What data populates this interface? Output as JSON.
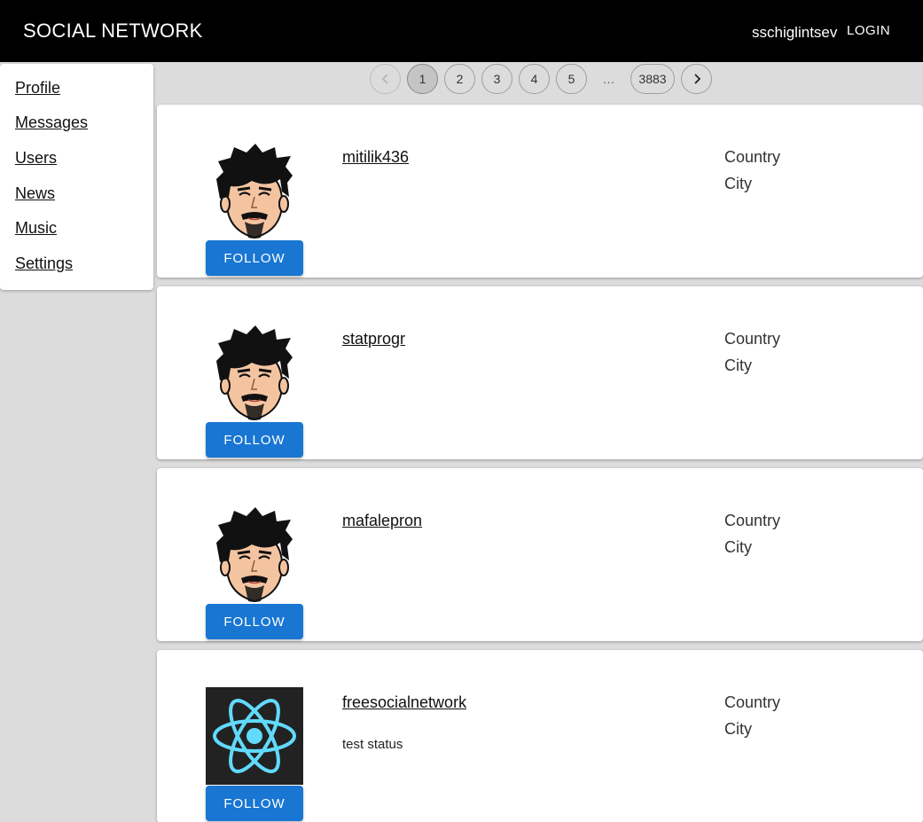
{
  "header": {
    "title": "SOCIAL NETWORK",
    "username": "sschiglintsev",
    "login_label": "LOGIN",
    "background": "#000000"
  },
  "sidebar": {
    "items": [
      {
        "label": "Profile"
      },
      {
        "label": "Messages"
      },
      {
        "label": "Users"
      },
      {
        "label": "News"
      },
      {
        "label": "Music"
      },
      {
        "label": "Settings"
      }
    ]
  },
  "pagination": {
    "prev_icon": "chevron-left-icon",
    "next_icon": "chevron-right-icon",
    "pages": [
      "1",
      "2",
      "3",
      "4",
      "5"
    ],
    "selected": "1",
    "ellipsis": "…",
    "last_page": "3883"
  },
  "users": [
    {
      "name": "mitilik436",
      "status": "",
      "country": "Country",
      "city": "City",
      "avatar": "default-avatar",
      "follow_label": "FOLLOW"
    },
    {
      "name": "statprogr",
      "status": "",
      "country": "Country",
      "city": "City",
      "avatar": "default-avatar",
      "follow_label": "FOLLOW"
    },
    {
      "name": "mafalepron",
      "status": "",
      "country": "Country",
      "city": "City",
      "avatar": "default-avatar",
      "follow_label": "FOLLOW"
    },
    {
      "name": "freesocialnetwork",
      "status": "test status",
      "country": "Country",
      "city": "City",
      "avatar": "react-logo",
      "follow_label": "FOLLOW"
    }
  ],
  "colors": {
    "accent": "#1976d2",
    "page_background": "#dcdcdc",
    "react_logo": "#61dafb"
  }
}
